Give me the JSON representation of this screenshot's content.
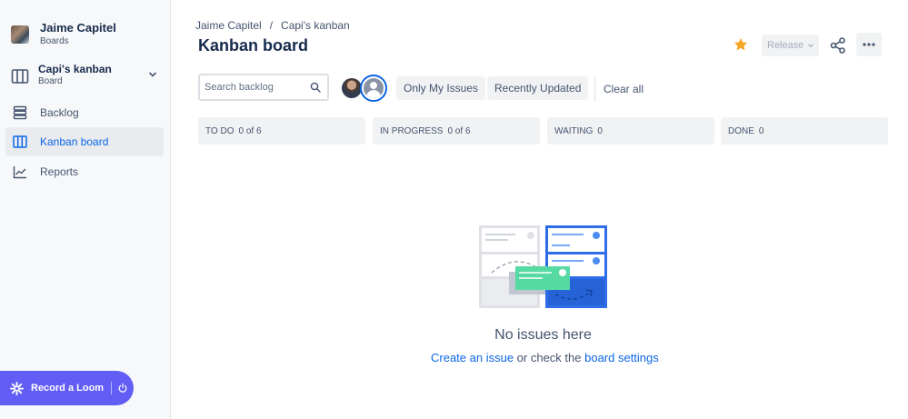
{
  "sidebar": {
    "project": {
      "name": "Jaime Capitel",
      "type": "Boards"
    },
    "board_selector": {
      "name": "Capi's kanban",
      "type": "Board"
    },
    "items": [
      {
        "label": "Backlog",
        "icon": "backlog-icon",
        "active": false
      },
      {
        "label": "Kanban board",
        "icon": "board-icon",
        "active": true
      },
      {
        "label": "Reports",
        "icon": "reports-icon",
        "active": false
      }
    ],
    "loom": {
      "label": "Record a Loom"
    }
  },
  "header": {
    "breadcrumbs": [
      "Jaime Capitel",
      "Capi's kanban"
    ],
    "separator": "/",
    "title": "Kanban board",
    "release_label": "Release"
  },
  "filters": {
    "search_placeholder": "Search backlog",
    "quick_filters": [
      "Only My Issues",
      "Recently Updated"
    ],
    "clear_label": "Clear all"
  },
  "columns": [
    {
      "name": "TO DO",
      "count": "0 of 6"
    },
    {
      "name": "IN PROGRESS",
      "count": "0 of 6"
    },
    {
      "name": "WAITING",
      "count": "0"
    },
    {
      "name": "DONE",
      "count": "0"
    }
  ],
  "empty_state": {
    "title": "No issues here",
    "link1": "Create an issue",
    "middle": " or check the ",
    "link2": "board settings"
  },
  "colors": {
    "accent": "#0c66e4",
    "star": "#f5a623",
    "loom": "#625df5",
    "sidebar_bg": "#f7f8f9",
    "column_bg": "#f1f2f4"
  }
}
